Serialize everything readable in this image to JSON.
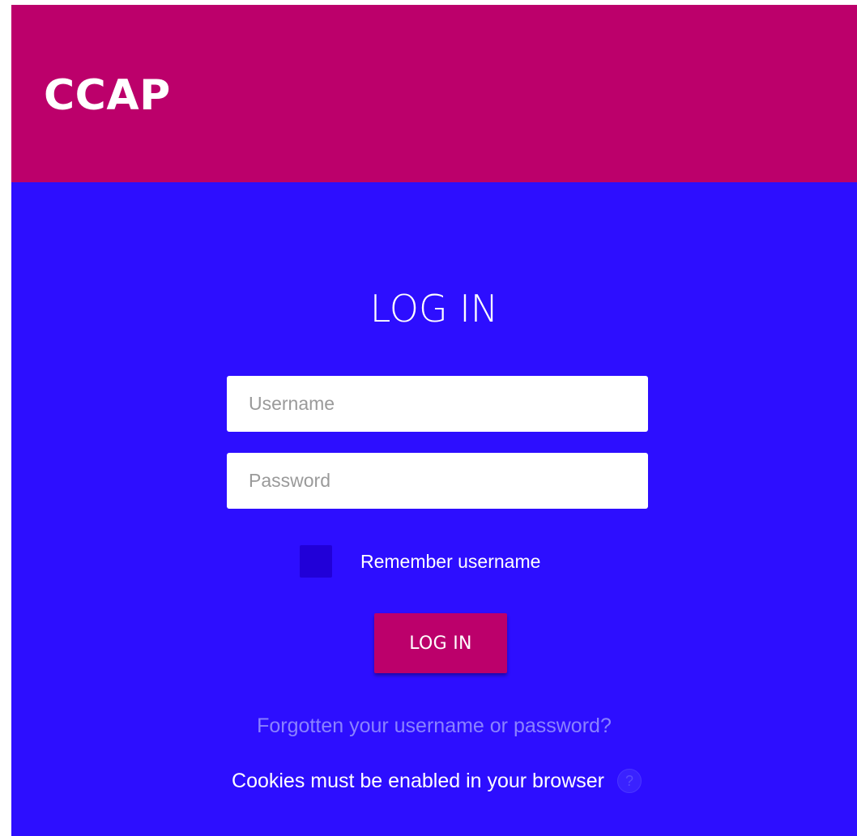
{
  "header": {
    "brand": "CCAP"
  },
  "login": {
    "title": "LOG IN",
    "username_placeholder": "Username",
    "password_placeholder": "Password",
    "remember_label": "Remember username",
    "remember_checked": false,
    "button_label": "LOG IN",
    "forgot_link": "Forgotten your username or password?",
    "cookies_notice": "Cookies must be enabled in your browser",
    "help_icon": "?"
  },
  "colors": {
    "header_bg": "#BC006B",
    "main_bg": "#2D0EFF",
    "button_bg": "#BC006B",
    "checkbox_bg": "#2100D8",
    "link_color": "#8a82ff"
  },
  "icons": {
    "help": "help-circle-icon"
  }
}
